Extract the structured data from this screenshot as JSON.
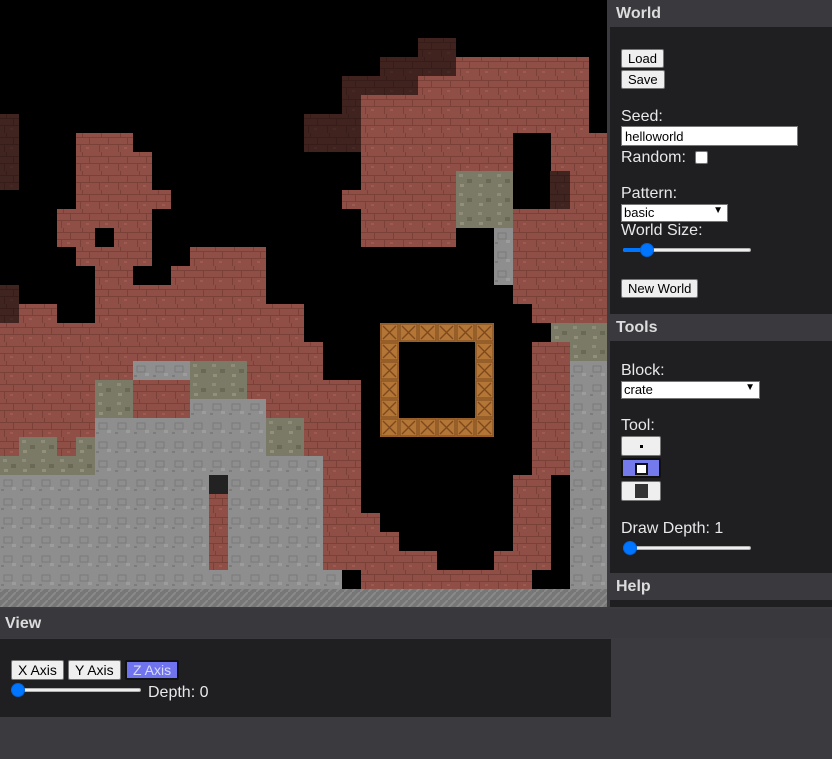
{
  "world": {
    "heading": "World",
    "load_label": "Load",
    "save_label": "Save",
    "seed_label": "Seed:",
    "seed_value": "helloworld",
    "random_label": "Random:",
    "random_checked": false,
    "pattern_label": "Pattern:",
    "pattern_value": "basic",
    "world_size_label": "World Size:",
    "world_size_level": 0.17,
    "new_world_label": "New World"
  },
  "tools": {
    "heading": "Tools",
    "block_label": "Block:",
    "block_value": "crate",
    "tool_label": "Tool:",
    "tool_buttons": [
      {
        "icon": "dot-icon",
        "selected": false
      },
      {
        "icon": "hollow-square-icon",
        "selected": true
      },
      {
        "icon": "filled-square-icon",
        "selected": false
      }
    ],
    "draw_depth_label": "Draw Depth: 1",
    "draw_depth_level": 0.0
  },
  "help": {
    "heading": "Help"
  },
  "view": {
    "heading": "View",
    "axis_buttons": [
      {
        "label": "X Axis",
        "active": false
      },
      {
        "label": "Y Axis",
        "active": false
      },
      {
        "label": "Z Axis",
        "active": true
      }
    ],
    "depth_label": "Depth: 0",
    "depth_level": 0.0
  },
  "colors": {
    "brick": "#8f4f46",
    "stone": "#8d8d8d",
    "gravel": "#7c7a64",
    "crate": "#b7793d",
    "accent": "#0075ff",
    "selected_button": "#7479ec"
  }
}
